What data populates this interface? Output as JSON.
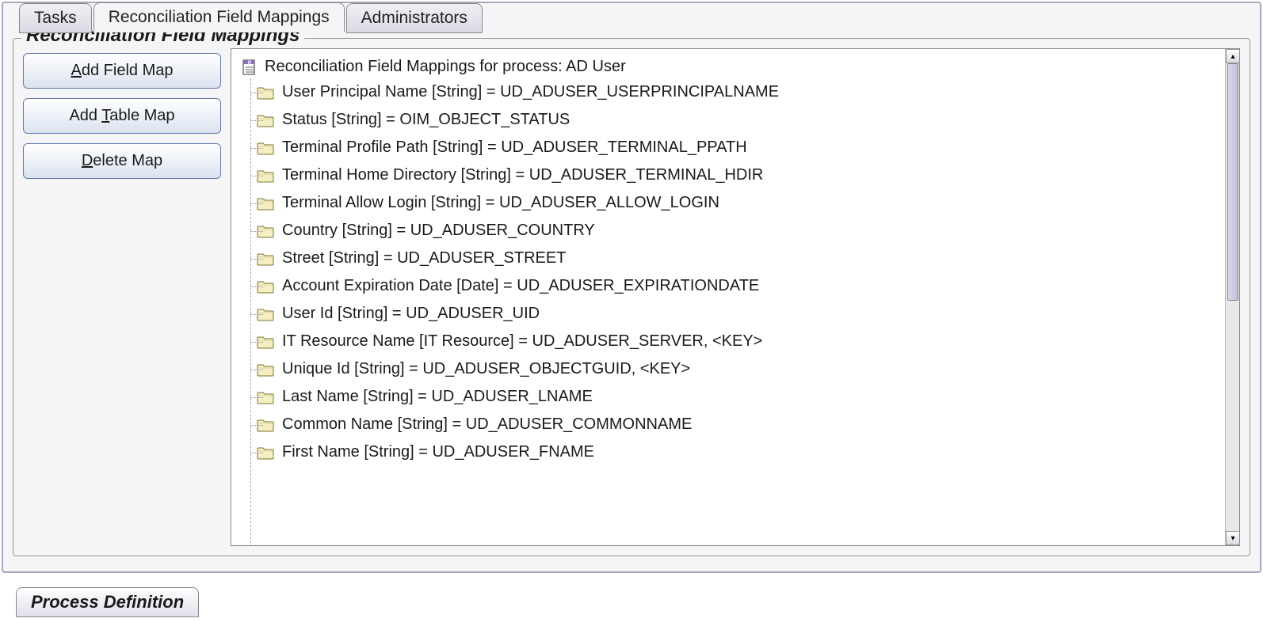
{
  "tabs": {
    "top": [
      {
        "label": "Tasks",
        "active": false
      },
      {
        "label": "Reconciliation Field Mappings",
        "active": true
      },
      {
        "label": "Administrators",
        "active": false
      }
    ],
    "bottom": {
      "label": "Process Definition"
    }
  },
  "fieldset": {
    "legend": "Reconciliation Field Mappings"
  },
  "buttons": {
    "addField": {
      "pre": "",
      "mnemonic": "A",
      "post": "dd Field Map"
    },
    "addTable": {
      "pre": "Add ",
      "mnemonic": "T",
      "post": "able Map"
    },
    "deleteMap": {
      "pre": "",
      "mnemonic": "D",
      "post": "elete Map"
    }
  },
  "tree": {
    "rootLabel": "Reconciliation Field Mappings for process: AD User",
    "items": [
      {
        "label": "User Principal Name [String] = UD_ADUSER_USERPRINCIPALNAME"
      },
      {
        "label": "Status [String] = OIM_OBJECT_STATUS"
      },
      {
        "label": "Terminal Profile Path [String] = UD_ADUSER_TERMINAL_PPATH"
      },
      {
        "label": "Terminal Home Directory [String] = UD_ADUSER_TERMINAL_HDIR"
      },
      {
        "label": "Terminal Allow Login [String] = UD_ADUSER_ALLOW_LOGIN"
      },
      {
        "label": "Country [String] = UD_ADUSER_COUNTRY"
      },
      {
        "label": "Street [String] = UD_ADUSER_STREET"
      },
      {
        "label": "Account Expiration Date [Date] = UD_ADUSER_EXPIRATIONDATE"
      },
      {
        "label": "User Id [String] = UD_ADUSER_UID"
      },
      {
        "label": "IT Resource Name [IT Resource] = UD_ADUSER_SERVER, <KEY>"
      },
      {
        "label": "Unique Id [String] = UD_ADUSER_OBJECTGUID, <KEY>"
      },
      {
        "label": "Last Name [String] = UD_ADUSER_LNAME"
      },
      {
        "label": "Common Name [String] = UD_ADUSER_COMMONNAME"
      },
      {
        "label": "First Name [String] = UD_ADUSER_FNAME"
      }
    ]
  }
}
